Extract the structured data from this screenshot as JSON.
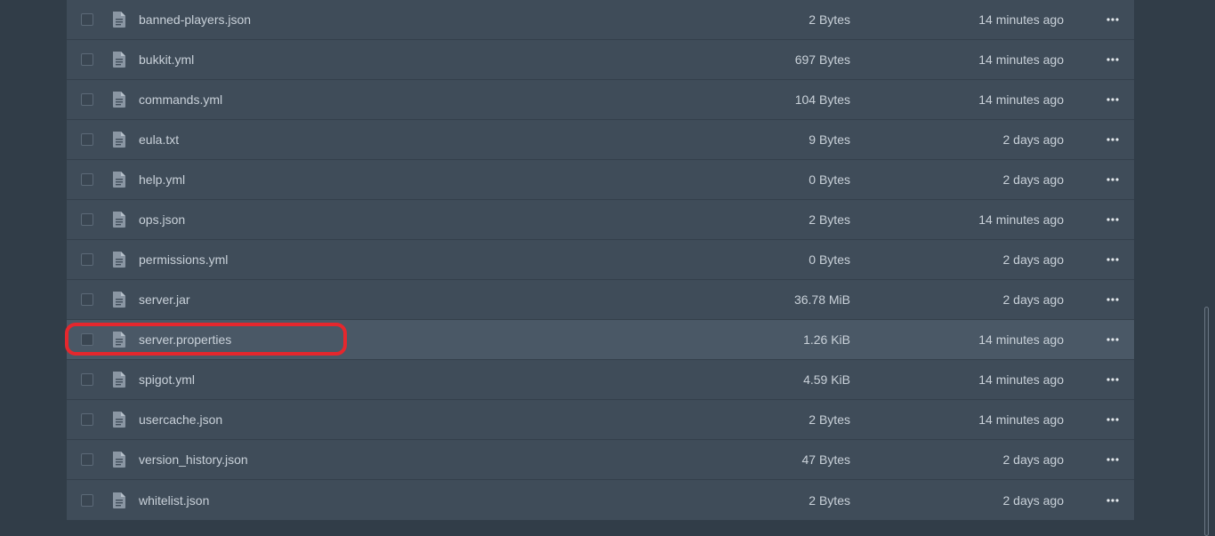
{
  "files": [
    {
      "name": "banned-players.json",
      "size": "2 Bytes",
      "modified": "14 minutes ago"
    },
    {
      "name": "bukkit.yml",
      "size": "697 Bytes",
      "modified": "14 minutes ago"
    },
    {
      "name": "commands.yml",
      "size": "104 Bytes",
      "modified": "14 minutes ago"
    },
    {
      "name": "eula.txt",
      "size": "9 Bytes",
      "modified": "2 days ago"
    },
    {
      "name": "help.yml",
      "size": "0 Bytes",
      "modified": "2 days ago"
    },
    {
      "name": "ops.json",
      "size": "2 Bytes",
      "modified": "14 minutes ago"
    },
    {
      "name": "permissions.yml",
      "size": "0 Bytes",
      "modified": "2 days ago"
    },
    {
      "name": "server.jar",
      "size": "36.78 MiB",
      "modified": "2 days ago"
    },
    {
      "name": "server.properties",
      "size": "1.26 KiB",
      "modified": "14 minutes ago",
      "highlighted": true
    },
    {
      "name": "spigot.yml",
      "size": "4.59 KiB",
      "modified": "14 minutes ago"
    },
    {
      "name": "usercache.json",
      "size": "2 Bytes",
      "modified": "14 minutes ago"
    },
    {
      "name": "version_history.json",
      "size": "47 Bytes",
      "modified": "2 days ago"
    },
    {
      "name": "whitelist.json",
      "size": "2 Bytes",
      "modified": "2 days ago"
    }
  ],
  "icons": {
    "file": "file-text-icon",
    "menu": "more-horizontal-icon"
  },
  "colors": {
    "annotation": "#e5272d",
    "row_highlight": "#4a5866"
  }
}
